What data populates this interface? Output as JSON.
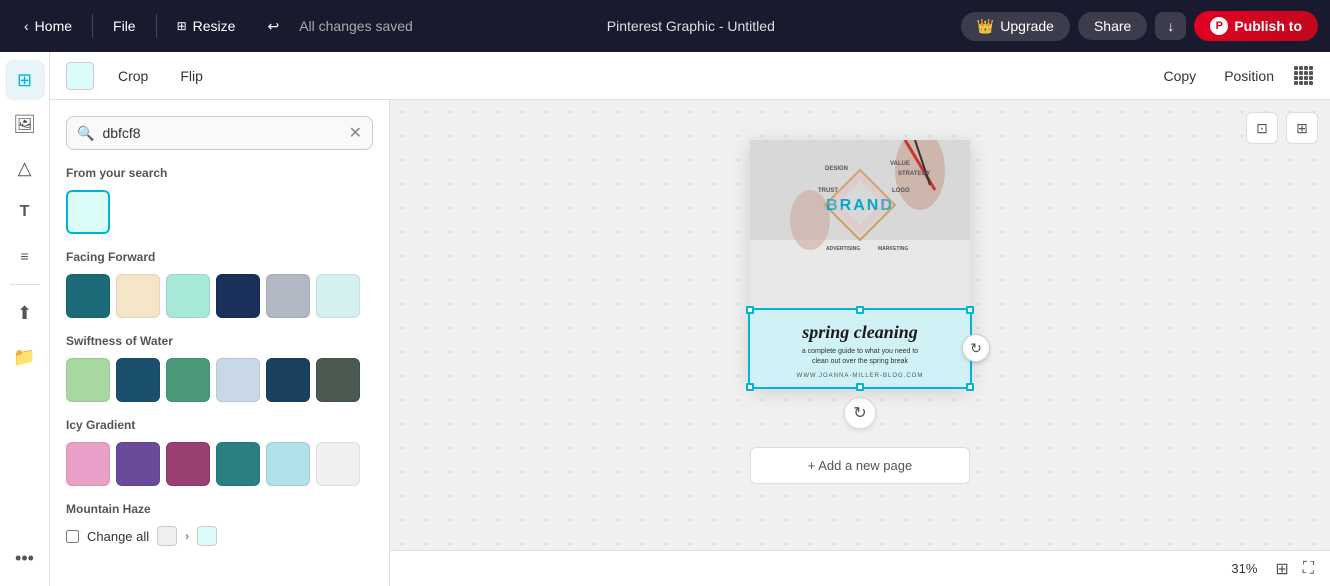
{
  "navbar": {
    "home_label": "Home",
    "file_label": "File",
    "resize_label": "Resize",
    "undo_icon": "↩",
    "saved_text": "All changes saved",
    "title": "Pinterest Graphic - Untitled",
    "upgrade_label": "Upgrade",
    "share_label": "Share",
    "download_icon": "↓",
    "publish_label": "Publish to"
  },
  "toolbar": {
    "swatch_color": "#dbfcf8",
    "crop_label": "Crop",
    "flip_label": "Flip",
    "copy_label": "Copy",
    "position_label": "Position"
  },
  "left_sidebar": {
    "icons": [
      {
        "name": "grid-icon",
        "symbol": "⊞",
        "active": true
      },
      {
        "name": "image-icon",
        "symbol": "🖼"
      },
      {
        "name": "shapes-icon",
        "symbol": "△"
      },
      {
        "name": "text-icon",
        "symbol": "T"
      },
      {
        "name": "lines-icon",
        "symbol": "≡"
      },
      {
        "name": "upload-icon",
        "symbol": "↑"
      },
      {
        "name": "folder-icon",
        "symbol": "📁"
      },
      {
        "name": "more-icon",
        "symbol": "···"
      }
    ]
  },
  "color_panel": {
    "search_placeholder": "dbfcf8",
    "search_value": "dbfcf8",
    "from_search_label": "From your search",
    "search_result_color": "#dbfcf8",
    "sections": [
      {
        "title": "Facing Forward",
        "colors": [
          "#1b6b78",
          "#f5e6c8",
          "#a8e8d8",
          "#1a2f5a",
          "#b0b8c4",
          "#d4f0f0"
        ]
      },
      {
        "title": "Swiftness of Water",
        "colors": [
          "#a8d8a0",
          "#1a4f6e",
          "#4a9a7a",
          "#c8d8e8",
          "#1a4060",
          "#4a5a50"
        ]
      },
      {
        "title": "Icy Gradient",
        "colors": [
          "#e8a0c8",
          "#6a4a9a",
          "#9a4070",
          "#2a8080",
          "#b0e0e8",
          "#f0f0f0"
        ]
      }
    ],
    "mountain_haze_label": "Mountain Haze",
    "change_all_label": "Change all",
    "change_all_from_color": "#f0f0f0",
    "change_all_to_color": "#dbfcf8"
  },
  "canvas": {
    "controls": [
      "⊡",
      "⊞"
    ],
    "design": {
      "strategy_words": [
        "VALUE",
        "STRATEGY",
        "DESIGN",
        "TRUST",
        "LOGO",
        "ADVERTISING",
        "MARKETING"
      ],
      "brand_text": "BRAND",
      "spring_title": "spring cleaning",
      "spring_sub": "a complete guide to what you need to\nclean out over the spring break",
      "spring_url": "WWW.JOANNA-MILLER-BLOG.COM"
    },
    "add_page_label": "+ Add a new page",
    "zoom_level": "31%"
  }
}
